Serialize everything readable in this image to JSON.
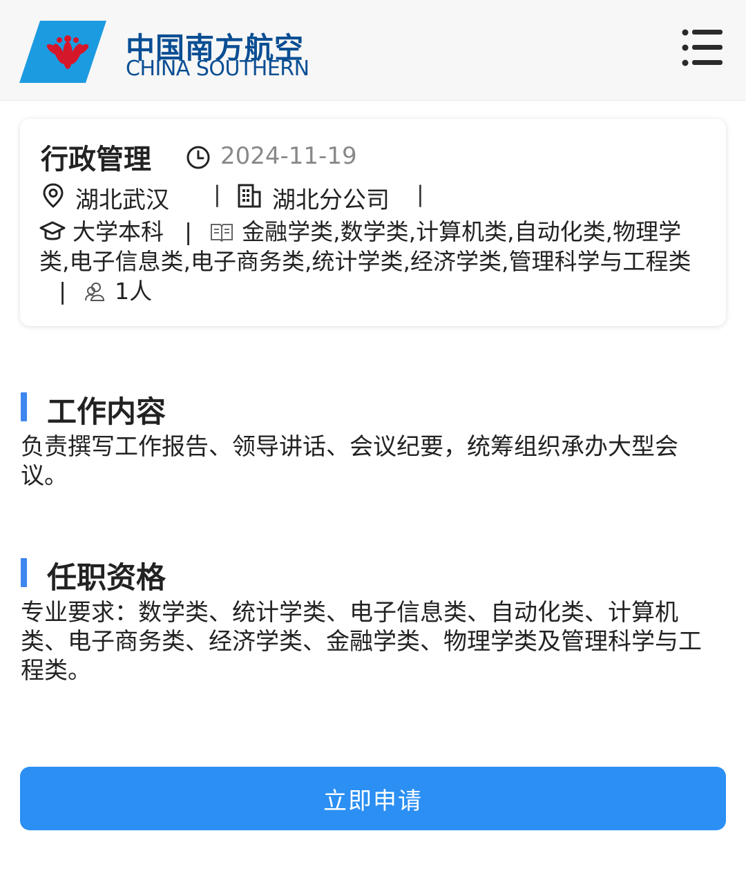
{
  "header": {
    "brand_cn": "中国南方航空",
    "brand_en": "CHINA SOUTHERN",
    "logo_icon": "kapok-flower-logo-icon",
    "menu_icon": "menu-list-icon"
  },
  "job": {
    "title": "行政管理",
    "date": "2024-11-19",
    "location": "湖北武汉",
    "company": "湖北分公司",
    "education": "大学本科",
    "majors": "金融学类,数学类,计算机类,自动化类,物理学类,电子信息类,电子商务类,统计学类,经济学类,管理科学与工程类",
    "headcount": "1人",
    "separator": "|"
  },
  "sections": {
    "work_title": "工作内容",
    "work_body": "负责撰写工作报告、领导讲话、会议纪要，统筹组织承办大型会议。",
    "qual_title": "任职资格",
    "qual_body": "专业要求：数学类、统计学类、电子信息类、自动化类、计算机类、电子商务类、经济学类、金融学类、物理学类及管理科学与工程类。"
  },
  "apply_label": "立即申请",
  "colors": {
    "brand_blue": "#0a4e93",
    "logo_sky": "#1c9be0",
    "logo_red": "#d6172a",
    "accent_bar": "#3e86f0",
    "button": "#2b8ff3"
  }
}
